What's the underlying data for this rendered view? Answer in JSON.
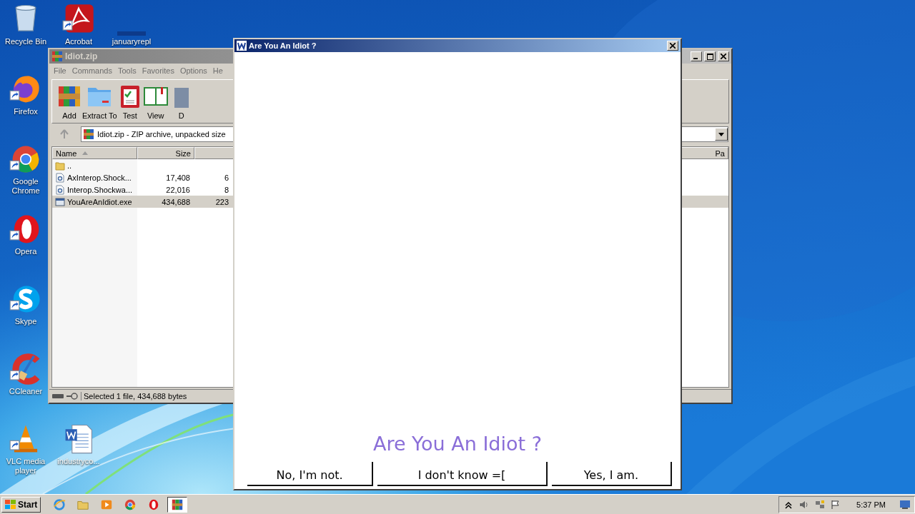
{
  "desktop_icons": [
    {
      "label": "Recycle Bin",
      "kind": "recycle",
      "shortcut": false
    },
    {
      "label": "Acrobat",
      "kind": "acrobat",
      "shortcut": true
    },
    {
      "label": "januaryrepl",
      "kind": "blank",
      "shortcut": false
    },
    {
      "label": "Firefox",
      "kind": "firefox",
      "shortcut": true
    },
    {
      "label": "Google Chrome",
      "kind": "chrome",
      "shortcut": true
    },
    {
      "label": "Opera",
      "kind": "opera",
      "shortcut": true
    },
    {
      "label": "Skype",
      "kind": "skype",
      "shortcut": true
    },
    {
      "label": "CCleaner",
      "kind": "ccleaner",
      "shortcut": true
    },
    {
      "label": "VLC media player",
      "kind": "vlc",
      "shortcut": true
    },
    {
      "label": "industryco...",
      "kind": "word",
      "shortcut": false
    }
  ],
  "archive_window": {
    "title": "Idiot.zip",
    "menu": [
      "File",
      "Commands",
      "Tools",
      "Favorites",
      "Options",
      "He"
    ],
    "toolbar": [
      {
        "label": "Add",
        "kind": "add"
      },
      {
        "label": "Extract To",
        "kind": "extract"
      },
      {
        "label": "Test",
        "kind": "test"
      },
      {
        "label": "View",
        "kind": "view"
      },
      {
        "label": "D",
        "kind": "delete"
      }
    ],
    "address": "Idiot.zip - ZIP archive, unpacked size",
    "columns": [
      "Name",
      "Size",
      "Pa"
    ],
    "rows": [
      {
        "name": "..",
        "size": "",
        "packed": "",
        "kind": "folder",
        "selected": false
      },
      {
        "name": "AxInterop.Shock...",
        "size": "17,408",
        "packed": "6",
        "kind": "dll",
        "selected": false
      },
      {
        "name": "Interop.Shockwa...",
        "size": "22,016",
        "packed": "8",
        "kind": "dll",
        "selected": false
      },
      {
        "name": "YouAreAnIdiot.exe",
        "size": "434,688",
        "packed": "223",
        "kind": "exe",
        "selected": true
      }
    ],
    "status": "Selected 1 file, 434,688 bytes"
  },
  "dialog": {
    "title": "Are You An Idiot ?",
    "heading": "Are You An Idiot ?",
    "buttons": [
      "No, I'm not.",
      "I don't know =[",
      "Yes, I am."
    ]
  },
  "taskbar": {
    "start": "Start",
    "apps": [
      {
        "kind": "ie",
        "selected": false
      },
      {
        "kind": "explorer",
        "selected": false
      },
      {
        "kind": "media",
        "selected": false
      },
      {
        "kind": "chrome",
        "selected": false
      },
      {
        "kind": "opera",
        "selected": false
      },
      {
        "kind": "winrar",
        "selected": true
      }
    ],
    "time": "5:37 PM"
  }
}
